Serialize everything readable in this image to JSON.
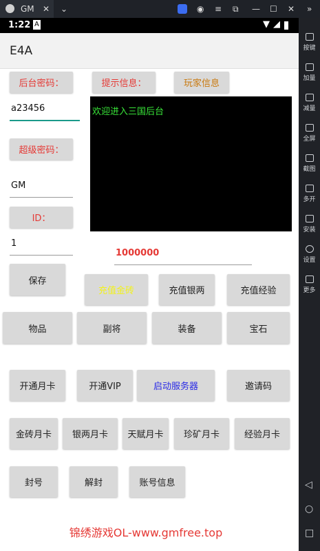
{
  "window": {
    "tab_title": "GM",
    "side_items": [
      "按键",
      "加量",
      "减量",
      "全屏",
      "截图",
      "多开",
      "安装",
      "设置",
      "更多"
    ]
  },
  "status_bar": {
    "time": "1:22",
    "indicator": "A"
  },
  "app": {
    "title": "E4A"
  },
  "labels": {
    "admin_password": "后台密码：",
    "hint_info": "提示信息：",
    "player_info": "玩家信息",
    "super_password": "超级密码：",
    "id": "ID："
  },
  "fields": {
    "admin_password_value": "a23456",
    "super_password_value": "GM",
    "id_value": "1",
    "amount_value": "1000000"
  },
  "console": {
    "message": "欢迎进入三国后台"
  },
  "buttons": {
    "save": "保存",
    "recharge_gold": "充值金砖",
    "recharge_silver": "充值银两",
    "recharge_exp": "充值经验",
    "items": "物品",
    "generals": "副将",
    "equipment": "装备",
    "gems": "宝石",
    "monthly_card": "开通月卡",
    "vip": "开通VIP",
    "start_server": "启动服务器",
    "invite_code": "邀请码",
    "gold_card": "金砖月卡",
    "silver_card": "银两月卡",
    "talent_card": "天赋月卡",
    "mine_card": "珍矿月卡",
    "exp_card": "经验月卡",
    "ban": "封号",
    "unban": "解封",
    "account_info": "账号信息"
  },
  "footer": {
    "text": "锦绣游戏OL-www.gmfree.top"
  },
  "colors": {
    "console_bg": "#000000",
    "console_text": "#39e639",
    "label_red": "#e53935",
    "accent_teal": "#1a9a8a",
    "start_server_text": "#2a2ae6",
    "recharge_gold_text": "#f2f21a"
  }
}
